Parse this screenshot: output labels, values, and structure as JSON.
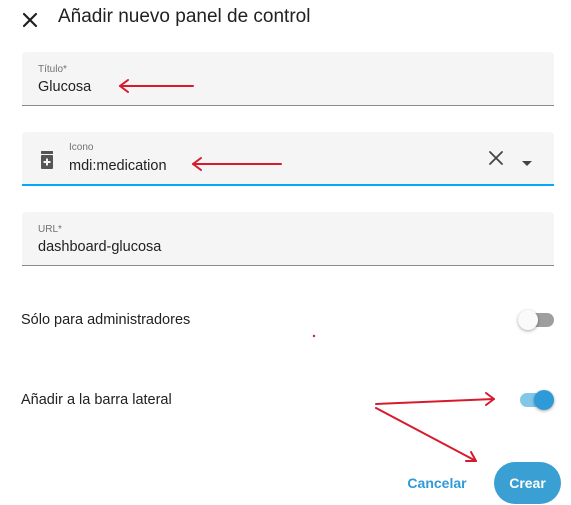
{
  "dialog": {
    "title": "Añadir nuevo panel de control"
  },
  "fields": {
    "title": {
      "label": "Título*",
      "value": "Glucosa"
    },
    "icon": {
      "label": "Icono",
      "value": "mdi:medication"
    },
    "url": {
      "label": "URL*",
      "value": "dashboard-glucosa"
    }
  },
  "toggles": {
    "admin_only": {
      "label": "Sólo para administradores",
      "checked": false
    },
    "sidebar": {
      "label": "Añadir a la barra lateral",
      "checked": true
    }
  },
  "actions": {
    "cancel_label": "Cancelar",
    "create_label": "Crear"
  },
  "colors": {
    "accent": "#03a9f4",
    "primary_button": "#3a9fd3",
    "annotation_arrow": "#d81b2c"
  },
  "icons": {
    "close": "close-icon",
    "prefix": "medication-icon",
    "clear": "clear-icon",
    "dropdown": "caret-down-icon"
  }
}
